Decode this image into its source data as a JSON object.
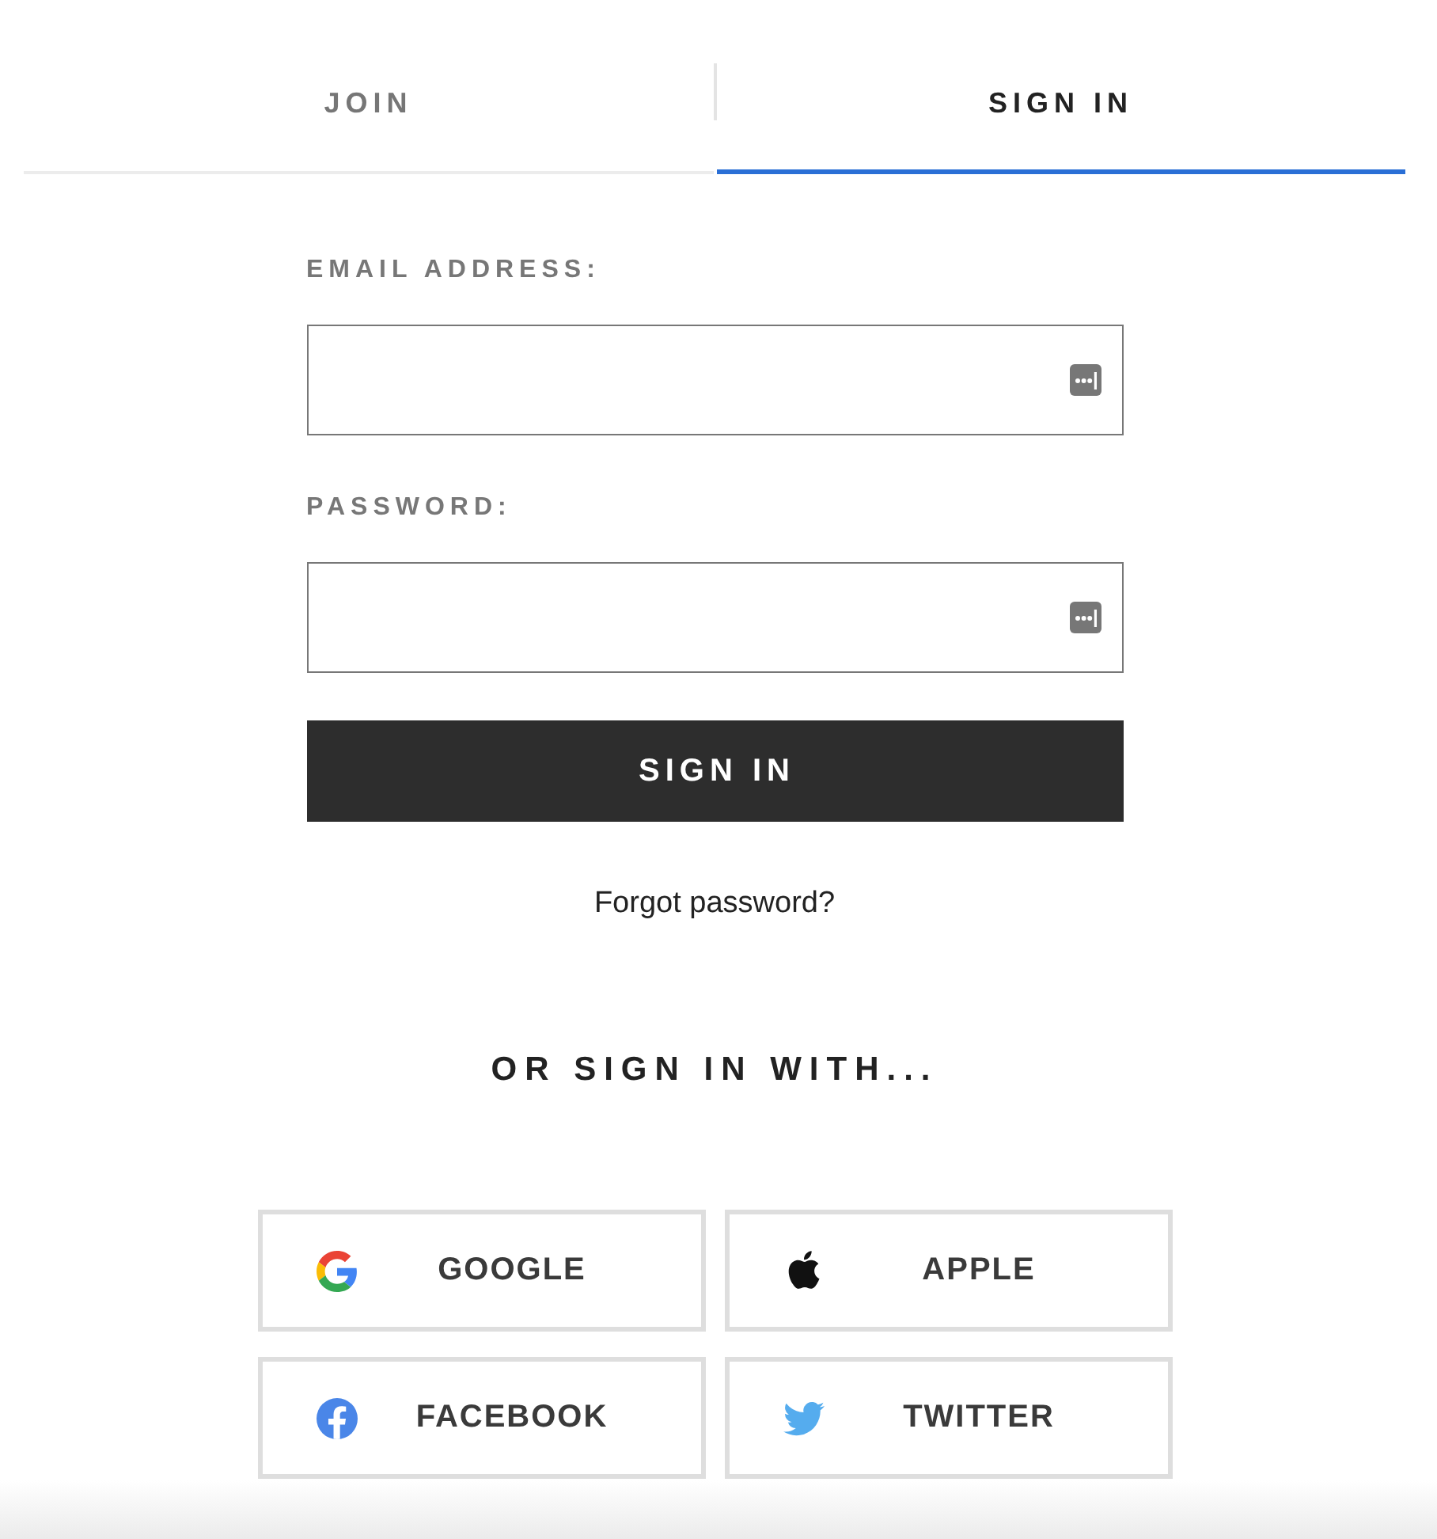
{
  "tabs": [
    {
      "label": "JOIN",
      "selected": false
    },
    {
      "label": "SIGN IN",
      "selected": true
    }
  ],
  "form": {
    "fields": [
      {
        "label": "EMAIL ADDRESS:"
      },
      {
        "label": "PASSWORD:"
      }
    ],
    "submit": "SIGN IN",
    "forgot_link": "Forgot password?"
  },
  "social": {
    "heading": "OR SIGN IN WITH...",
    "providers": [
      {
        "label": "GOOGLE",
        "kind": "google"
      },
      {
        "label": "APPLE",
        "kind": "apple"
      },
      {
        "label": "FACEBOOK",
        "kind": "facebook"
      },
      {
        "label": "TWITTER",
        "kind": "twitter"
      }
    ]
  }
}
